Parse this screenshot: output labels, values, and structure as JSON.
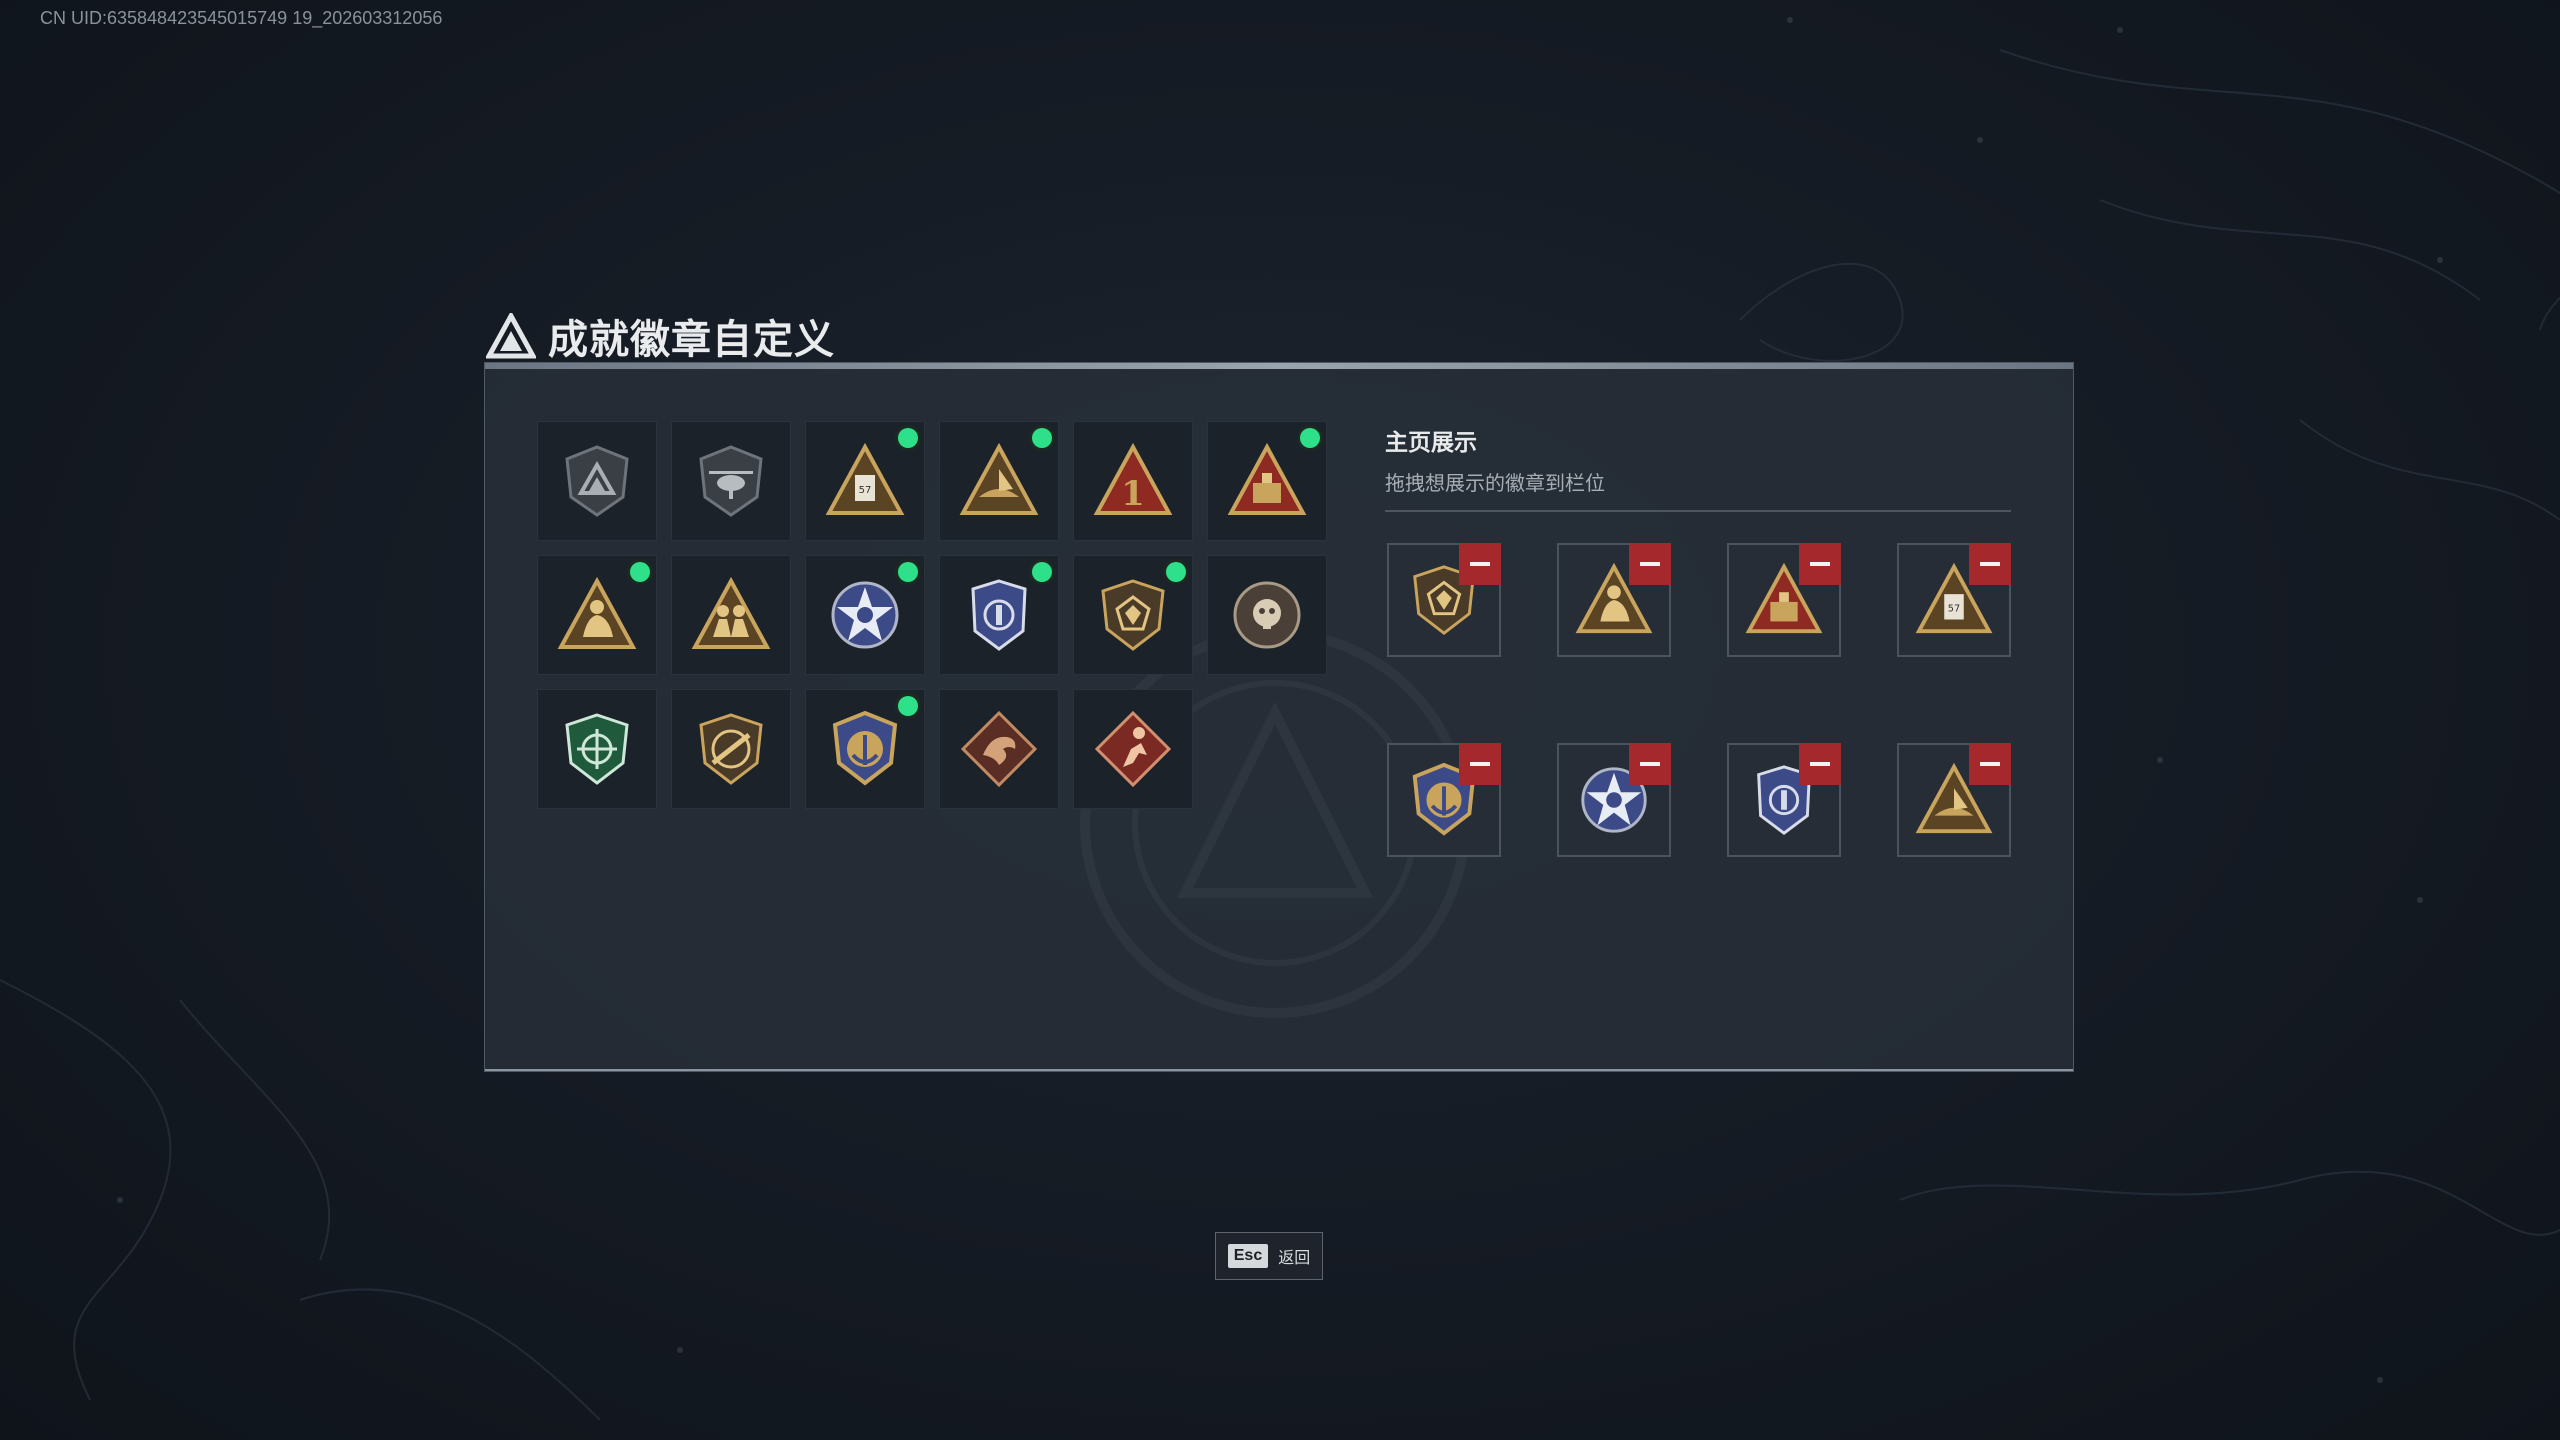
{
  "uid_text": "CN UID:635848423545015749 19_202603312056",
  "title": "成就徽章自定义",
  "title_icon": "delta-logo-icon",
  "badges": [
    {
      "icon": "shield-delta-gray",
      "new": false
    },
    {
      "icon": "shield-helicopter-gray",
      "new": false
    },
    {
      "icon": "triangle-canister-gold",
      "new": true
    },
    {
      "icon": "triangle-boat-gold",
      "new": true
    },
    {
      "icon": "triangle-number-one-red",
      "new": false
    },
    {
      "icon": "triangle-crate-red",
      "new": true
    },
    {
      "icon": "triangle-soldier-gold",
      "new": true
    },
    {
      "icon": "triangle-soldiers-gold",
      "new": false
    },
    {
      "icon": "star-medal-blue",
      "new": true
    },
    {
      "icon": "police-badge-blue",
      "new": true
    },
    {
      "icon": "shield-gem-bronze",
      "new": true
    },
    {
      "icon": "circle-skull-gray",
      "new": false
    },
    {
      "icon": "shield-crosshair-green",
      "new": false
    },
    {
      "icon": "shield-rifle-bronze",
      "new": false
    },
    {
      "icon": "shield-anchor-gold",
      "new": true
    },
    {
      "icon": "diamond-dragon-bronze",
      "new": false
    },
    {
      "icon": "diamond-runner-red",
      "new": false
    }
  ],
  "showcase": {
    "title": "主页展示",
    "subtitle": "拖拽想展示的徽章到栏位",
    "slots": [
      {
        "icon": "shield-gem-bronze"
      },
      {
        "icon": "triangle-soldier-gold"
      },
      {
        "icon": "triangle-crate-red"
      },
      {
        "icon": "triangle-canister-gold"
      },
      {
        "icon": "shield-anchor-gold"
      },
      {
        "icon": "star-medal-blue"
      },
      {
        "icon": "police-badge-blue"
      },
      {
        "icon": "triangle-boat-gold"
      }
    ]
  },
  "footer": {
    "esc_key": "Esc",
    "esc_label": "返回"
  },
  "colors": {
    "new_dot": "#2fe08a",
    "remove": "#a5282c",
    "gold": "#c9a45c",
    "red": "#8e2a22",
    "blue": "#3c4a88"
  }
}
